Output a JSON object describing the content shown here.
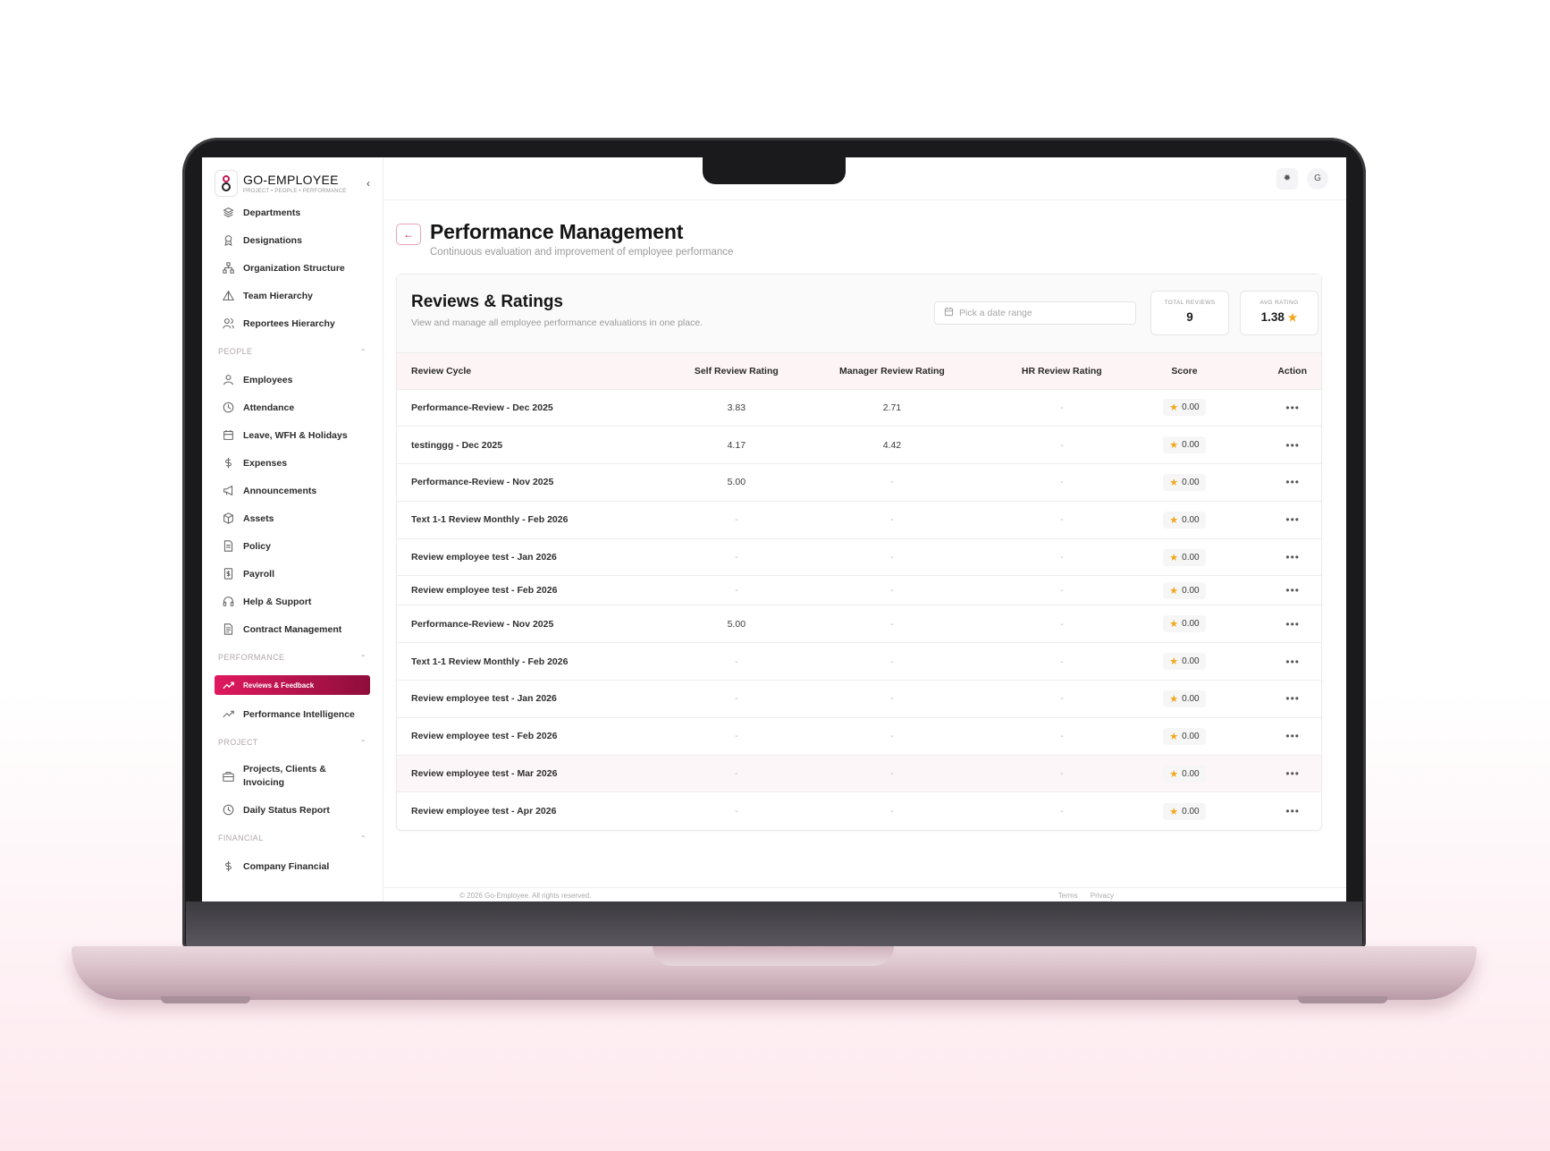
{
  "brand": {
    "name": "GO-EMPLOYEE",
    "tagline": "PROJECT • PEOPLE • PERFORMANCE"
  },
  "sidebar": {
    "top_items": [
      {
        "label": "Departments",
        "icon": "layers-icon"
      },
      {
        "label": "Designations",
        "icon": "badge-icon"
      },
      {
        "label": "Organization Structure",
        "icon": "org-chart-icon"
      },
      {
        "label": "Team Hierarchy",
        "icon": "triangle-icon"
      },
      {
        "label": "Reportees Hierarchy",
        "icon": "users-icon"
      }
    ],
    "sections": {
      "people": "PEOPLE",
      "performance": "PERFORMANCE",
      "project": "PROJECT",
      "financial": "FINANCIAL"
    },
    "people_items": [
      {
        "label": "Employees",
        "icon": "user-icon"
      },
      {
        "label": "Attendance",
        "icon": "clock-icon"
      },
      {
        "label": "Leave, WFH & Holidays",
        "icon": "calendar-icon"
      },
      {
        "label": "Expenses",
        "icon": "dollar-icon"
      },
      {
        "label": "Announcements",
        "icon": "megaphone-icon"
      },
      {
        "label": "Assets",
        "icon": "box-icon"
      },
      {
        "label": "Policy",
        "icon": "document-icon"
      },
      {
        "label": "Payroll",
        "icon": "receipt-icon"
      },
      {
        "label": "Help & Support",
        "icon": "headphones-icon"
      },
      {
        "label": "Contract Management",
        "icon": "contract-icon"
      }
    ],
    "performance_items": [
      {
        "label": "Reviews & Feedback",
        "icon": "trend-icon"
      },
      {
        "label": "Performance Intelligence",
        "icon": "trend-icon"
      }
    ],
    "project_items": [
      {
        "label_line1": "Projects, Clients &",
        "label_line2": "Invoicing",
        "icon": "briefcase-icon"
      },
      {
        "label": "Daily Status Report",
        "icon": "clock-icon"
      }
    ],
    "financial_items": [
      {
        "label": "Company Financial",
        "icon": "dollar-icon"
      }
    ]
  },
  "topbar": {
    "theme_icon": "sun-icon",
    "avatar_initial": "G"
  },
  "header": {
    "title": "Performance Management",
    "subtitle": "Continuous evaluation and improvement of employee performance"
  },
  "card": {
    "title": "Reviews & Ratings",
    "subtitle": "View and manage all employee performance evaluations in one place.",
    "date_placeholder": "Pick a date range",
    "stats": {
      "total_label": "TOTAL REVIEWS",
      "total_value": "9",
      "avg_label": "AVG RATING",
      "avg_value": "1.38"
    }
  },
  "table": {
    "headers": [
      "Review Cycle",
      "Self Review Rating",
      "Manager Review Rating",
      "HR Review Rating",
      "Score",
      "Action"
    ],
    "rows": [
      {
        "cycle": "Performance-Review - Dec 2025",
        "self": "3.83",
        "manager": "2.71",
        "hr": "-",
        "score": "0.00"
      },
      {
        "cycle": "testinggg - Dec 2025",
        "self": "4.17",
        "manager": "4.42",
        "hr": "-",
        "score": "0.00"
      },
      {
        "cycle": "Performance-Review - Nov 2025",
        "self": "5.00",
        "manager": "-",
        "hr": "-",
        "score": "0.00"
      },
      {
        "cycle": "Text 1-1 Review Monthly - Feb 2026",
        "self": "-",
        "manager": "-",
        "hr": "-",
        "score": "0.00"
      },
      {
        "cycle": "Review employee test - Jan 2026",
        "self": "-",
        "manager": "-",
        "hr": "-",
        "score": "0.00"
      },
      {
        "cycle": "Review employee test - Feb 2026",
        "self": "-",
        "manager": "-",
        "hr": "-",
        "score": "0.00"
      },
      {
        "cycle": "Performance-Review - Nov 2025",
        "self": "5.00",
        "manager": "-",
        "hr": "-",
        "score": "0.00"
      },
      {
        "cycle": "Text 1-1 Review Monthly - Feb 2026",
        "self": "-",
        "manager": "-",
        "hr": "-",
        "score": "0.00"
      },
      {
        "cycle": "Review employee test - Jan 2026",
        "self": "-",
        "manager": "-",
        "hr": "-",
        "score": "0.00"
      },
      {
        "cycle": "Review employee test - Feb 2026",
        "self": "-",
        "manager": "-",
        "hr": "-",
        "score": "0.00"
      },
      {
        "cycle": "Review employee test - Mar 2026",
        "self": "-",
        "manager": "-",
        "hr": "-",
        "score": "0.00"
      },
      {
        "cycle": "Review employee test - Apr 2026",
        "self": "-",
        "manager": "-",
        "hr": "-",
        "score": "0.00"
      }
    ],
    "action_glyph": "•••"
  },
  "footer": {
    "copyright": "© 2026 Go-Employee. All rights reserved.",
    "terms": "Terms",
    "privacy": "Privacy"
  },
  "colors": {
    "accent": "#d81b60",
    "accent_dark": "#8e0d3b",
    "star": "#f2a71a"
  }
}
